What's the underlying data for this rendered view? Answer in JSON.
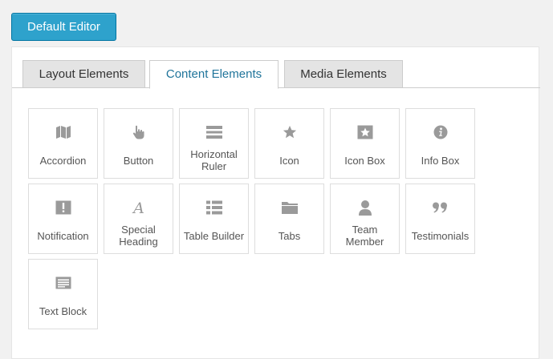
{
  "editor_button": {
    "label": "Default Editor"
  },
  "tabs": [
    {
      "label": "Layout Elements"
    },
    {
      "label": "Content Elements",
      "active": true
    },
    {
      "label": "Media Elements"
    }
  ],
  "elements": [
    {
      "label": "Accordion",
      "icon": "map-icon"
    },
    {
      "label": "Button",
      "icon": "pointer-hand-icon"
    },
    {
      "label": "Horizontal Ruler",
      "icon": "horizontal-ruler-icon"
    },
    {
      "label": "Icon",
      "icon": "star-icon"
    },
    {
      "label": "Icon Box",
      "icon": "star-box-icon"
    },
    {
      "label": "Info Box",
      "icon": "info-icon"
    },
    {
      "label": "Notification",
      "icon": "alert-icon"
    },
    {
      "label": "Special Heading",
      "icon": "script-letter-icon"
    },
    {
      "label": "Table Builder",
      "icon": "list-icon"
    },
    {
      "label": "Tabs",
      "icon": "folder-icon"
    },
    {
      "label": "Team Member",
      "icon": "person-icon"
    },
    {
      "label": "Testimonials",
      "icon": "quote-icon"
    },
    {
      "label": "Text Block",
      "icon": "text-block-icon"
    }
  ],
  "colors": {
    "accent": "#2ea2cc",
    "active_tab_text": "#21759b",
    "icon": "#9a9a9a"
  }
}
